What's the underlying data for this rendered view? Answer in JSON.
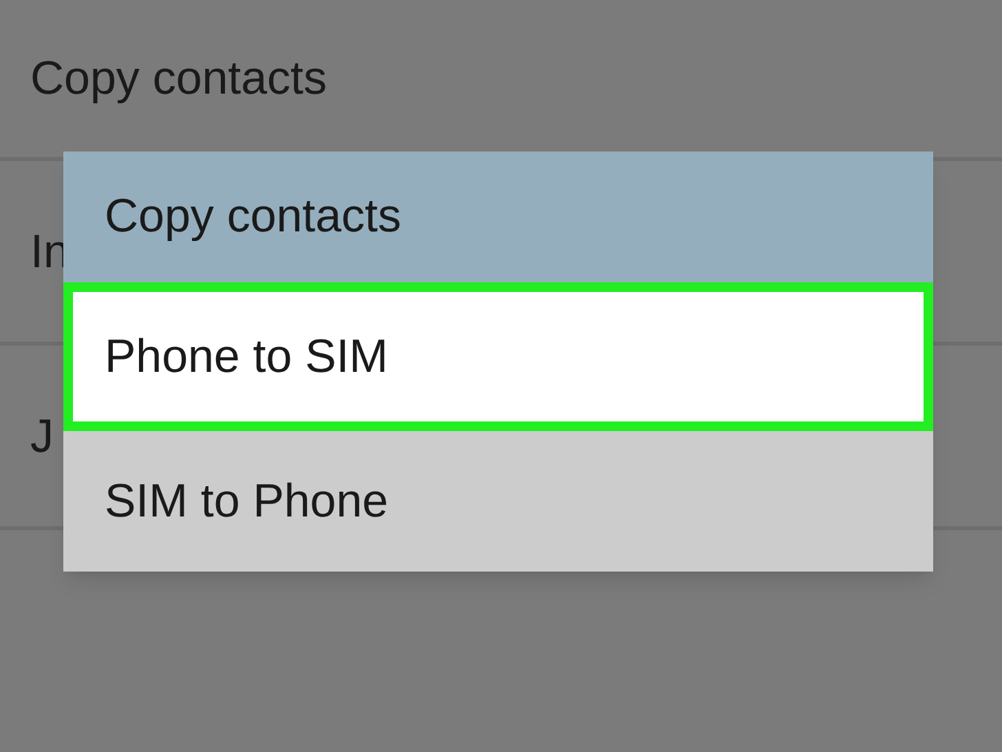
{
  "list": [
    {
      "label": "Copy contacts"
    },
    {
      "label": "In"
    },
    {
      "label": "J"
    }
  ],
  "dialog": {
    "title": "Copy contacts",
    "options": [
      {
        "label": "Phone to SIM",
        "selected": true
      },
      {
        "label": "SIM to Phone",
        "selected": false
      }
    ]
  }
}
